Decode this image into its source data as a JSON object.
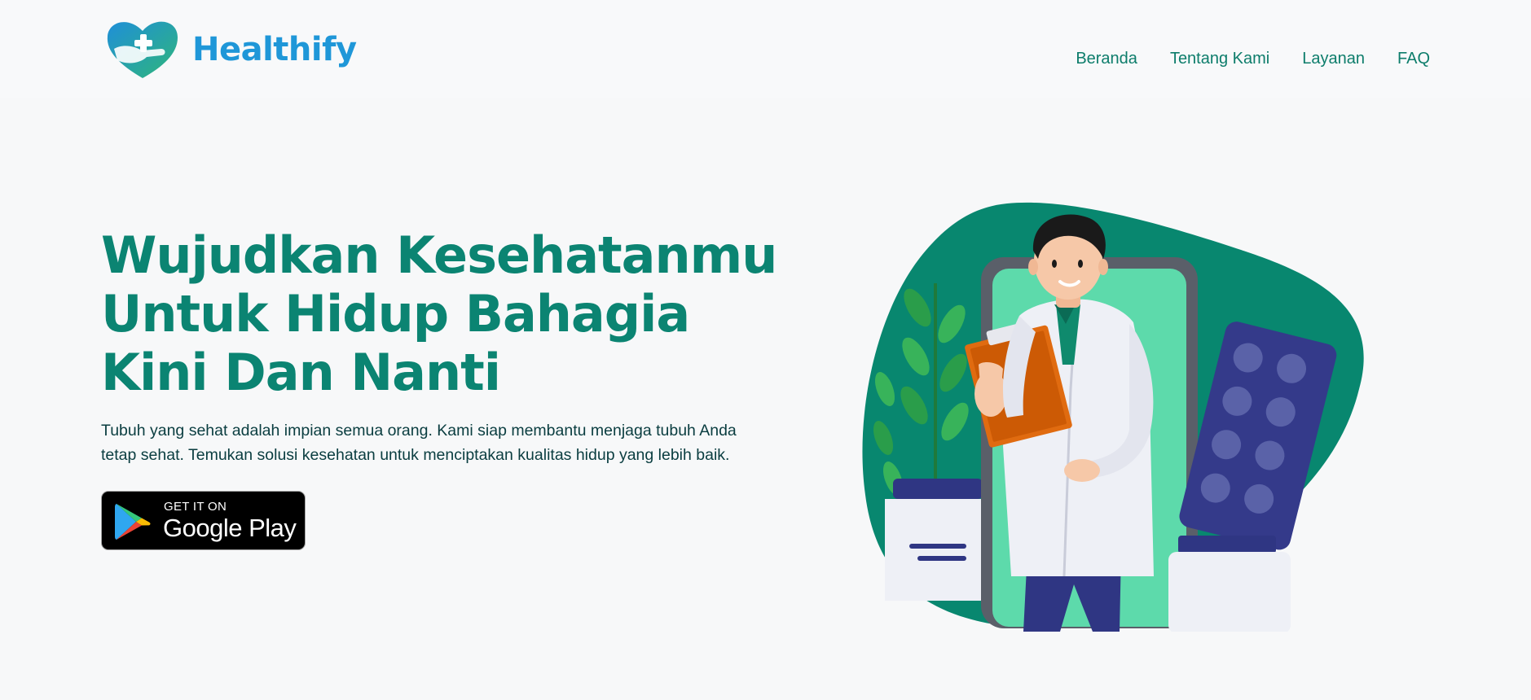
{
  "brand": {
    "name": "Healthify",
    "logo_icon": "heart-cross-hand-icon"
  },
  "nav": {
    "items": [
      {
        "label": "Beranda"
      },
      {
        "label": "Tentang Kami"
      },
      {
        "label": "Layanan"
      },
      {
        "label": "FAQ"
      }
    ]
  },
  "hero": {
    "title": "Wujudkan Kesehatanmu Untuk Hidup Bahagia Kini Dan Nanti",
    "description": "Tubuh yang sehat adalah impian semua orang. Kami siap membantu menjaga tubuh Anda tetap sehat. Temukan solusi kesehatan untuk menciptakan kualitas hidup yang lebih baik.",
    "store_badge": {
      "small": "GET IT ON",
      "big": "Google Play",
      "icon": "google-play-icon"
    },
    "illustration": "doctor-with-clipboard-illustration"
  },
  "colors": {
    "primary": "#0b8472",
    "nav": "#0d7d6b",
    "brand": "#1f97d8",
    "background": "#f7f8f9",
    "text": "#0a3d40"
  }
}
